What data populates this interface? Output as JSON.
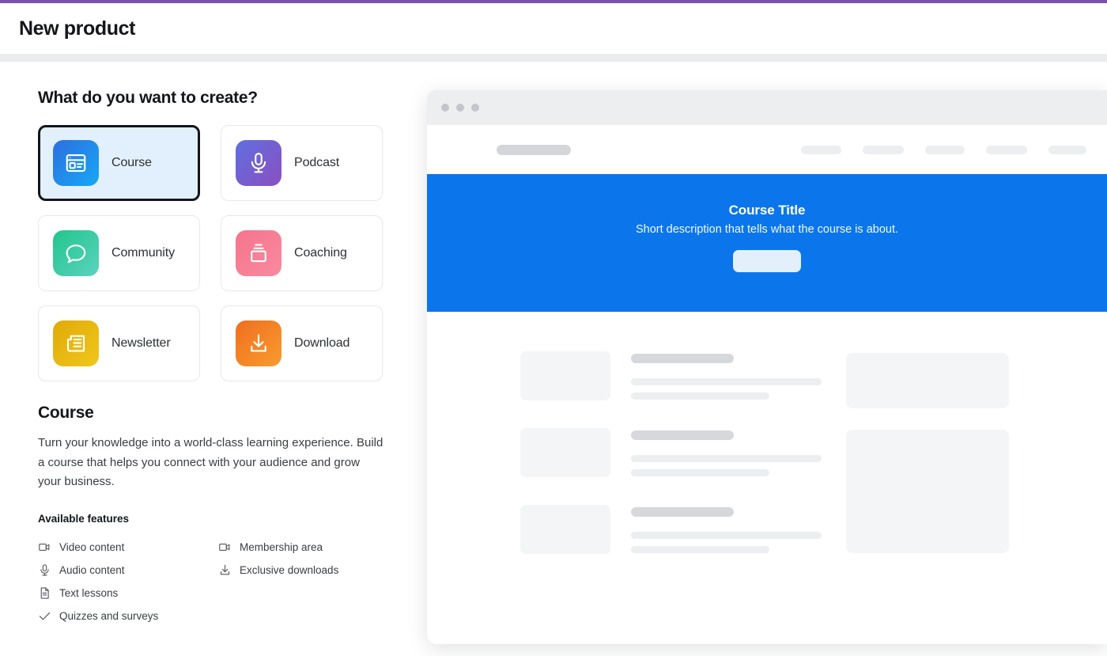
{
  "theme": {
    "accent_purple": "#7b52ab",
    "hero_blue": "#0b76eb",
    "selected_card_bg": "#e2f0fd",
    "selected_card_border": "#14161a"
  },
  "header": {
    "title": "New product"
  },
  "left_panel": {
    "question": "What do you want to create?",
    "product_types": [
      {
        "label": "Course",
        "icon": "course-window-icon",
        "selected": true
      },
      {
        "label": "Podcast",
        "icon": "microphone-icon",
        "selected": false
      },
      {
        "label": "Community",
        "icon": "chat-bubble-icon",
        "selected": false
      },
      {
        "label": "Coaching",
        "icon": "presentation-icon",
        "selected": false
      },
      {
        "label": "Newsletter",
        "icon": "newspaper-icon",
        "selected": false
      },
      {
        "label": "Download",
        "icon": "download-arrow-icon",
        "selected": false
      }
    ],
    "detail": {
      "title": "Course",
      "description": "Turn your knowledge into a world-class learning experience. Build a course that helps you connect with your audience and grow your business.",
      "features_heading": "Available features",
      "features": [
        {
          "label": "Video content",
          "icon": "video-camera-icon"
        },
        {
          "label": "Audio content",
          "icon": "microphone-icon"
        },
        {
          "label": "Text lessons",
          "icon": "document-icon"
        },
        {
          "label": "Quizzes and surveys",
          "icon": "check-icon"
        },
        {
          "label": "Membership area",
          "icon": "video-camera-icon"
        },
        {
          "label": "Exclusive downloads",
          "icon": "download-arrow-icon"
        }
      ]
    }
  },
  "preview": {
    "window_dots": 3,
    "nav": {
      "logo_placeholder": true,
      "link_placeholders": 5
    },
    "hero": {
      "title": "Course Title",
      "description": "Short description that tells what the course is about.",
      "cta_placeholder": true
    },
    "skeleton": {
      "rows": 3,
      "side_boxes": 2
    }
  }
}
